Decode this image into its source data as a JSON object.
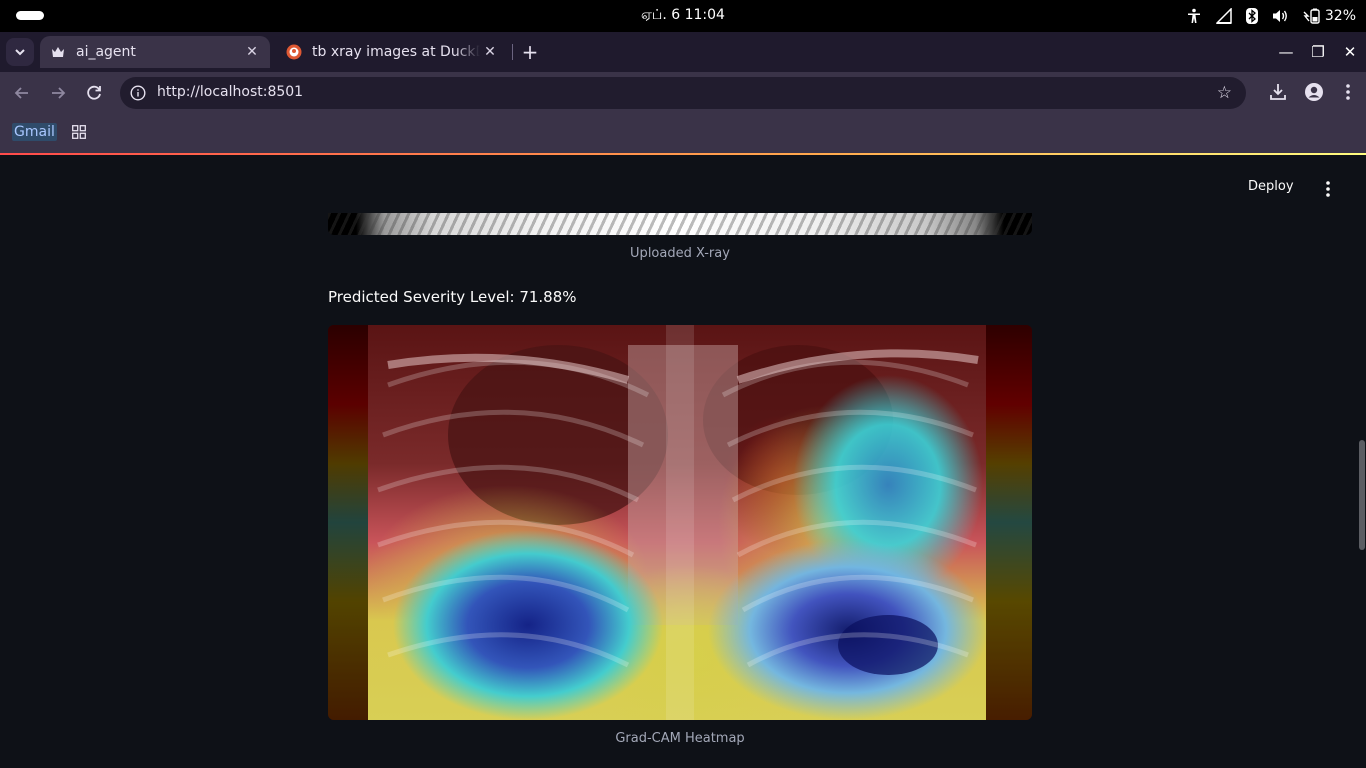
{
  "os": {
    "clock": "ஏப். 6  11:04",
    "battery": "32%"
  },
  "browser": {
    "tabs": [
      {
        "title": "ai_agent",
        "active": true
      },
      {
        "title": "tb xray images at DuckDuckGo",
        "active": false
      }
    ],
    "url": "http://localhost:8501",
    "bookmarks": [
      {
        "label": "Gmail"
      }
    ]
  },
  "app": {
    "deploy_label": "Deploy",
    "uploaded_caption": "Uploaded X-ray",
    "severity_text": "Predicted Severity Level: 71.88%",
    "heatmap_caption": "Grad-CAM Heatmap"
  },
  "colors": {
    "page_bg": "#0e1117",
    "browser_chrome": "#3a3348",
    "accent_line": "#ff4b4b"
  }
}
